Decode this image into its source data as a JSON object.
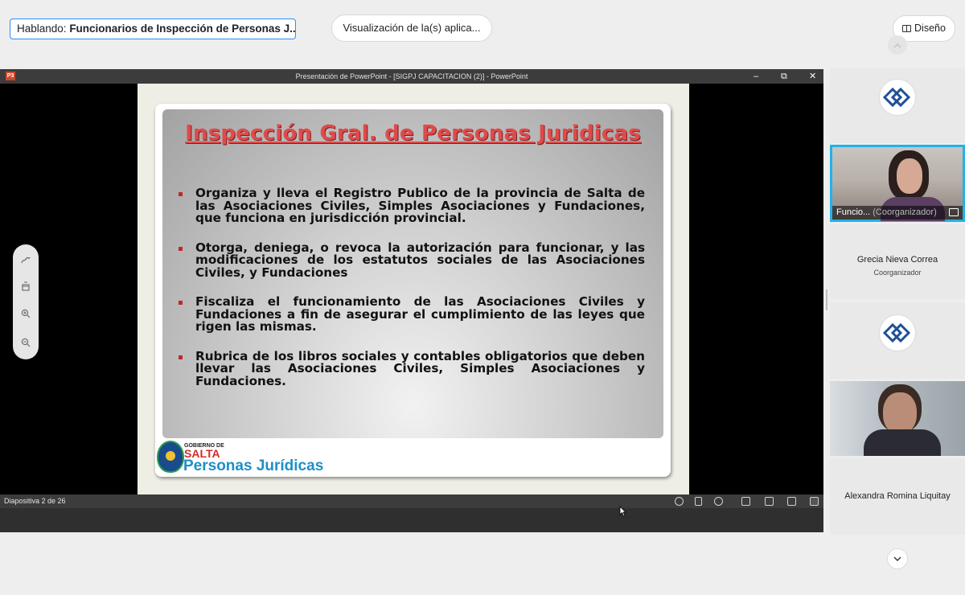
{
  "top_bar": {
    "speaking_prefix": "Hablando: ",
    "speaking_name": "Funcionarios de Inspección de Personas J...",
    "view_apps_label": "Visualización de la(s) aplica...",
    "layout_label": "Diseño"
  },
  "ppt": {
    "window_title": "Presentación de PowerPoint - [SIGPJ CAPACITACION (2)] - PowerPoint",
    "app_badge": "P3",
    "minimize": "–",
    "restore": "⧉",
    "close": "✕",
    "status_label": "Diapositiva 2 de 26"
  },
  "slide": {
    "title": "Inspección Gral. de Personas Juridicas",
    "bullets": [
      "Organiza y lleva el Registro Publico de la provincia de Salta de las Asociaciones Civiles, Simples Asociaciones y Fundaciones, que funciona en jurisdicción provincial.",
      "Otorga, deniega, o revoca la autorización para funcionar, y las modificaciones de los estatutos sociales de las Asociaciones Civiles, y Fundaciones",
      "Fiscaliza el funcionamiento de las Asociaciones Civiles y Fundaciones a fin de asegurar el cumplimiento de las leyes que rigen las mismas.",
      "Rubrica de los libros sociales y contables obligatorios que deben llevar las Asociaciones Civiles, Simples Asociaciones y Fundaciones."
    ],
    "logo_gobierno": "GOBIERNO DE",
    "logo_salta": "SALTA",
    "logo_pj": "Personas Jurídicas"
  },
  "participants": [
    {
      "name": "Funcio...",
      "role": "(Coorganizador)",
      "type": "video-active"
    },
    {
      "name": "Grecia Nieva Correa",
      "role": "Coorganizador",
      "type": "name-tile"
    },
    {
      "name": "Alexandra Romina Liquitay",
      "type": "name-tile"
    }
  ],
  "colors": {
    "accent": "#2d8cff",
    "slide_title": "#e04a4a",
    "bullet_marker": "#c0282a",
    "active_speaker_border": "#21b2e8"
  }
}
